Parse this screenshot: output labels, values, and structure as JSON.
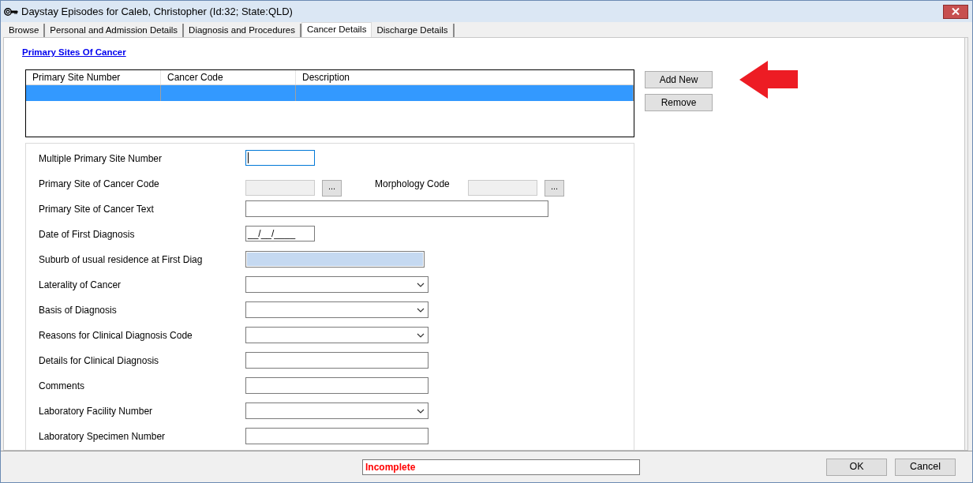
{
  "window": {
    "title": "Daystay Episodes for Caleb, Christopher (Id:32; State:QLD)"
  },
  "tabs": [
    {
      "label": "Browse",
      "selected": false
    },
    {
      "label": "Personal and Admission Details",
      "selected": false
    },
    {
      "label": "Diagnosis and Procedures",
      "selected": false
    },
    {
      "label": "Cancer Details",
      "selected": true
    },
    {
      "label": "Discharge Details",
      "selected": false
    }
  ],
  "section_link": "Primary Sites Of Cancer",
  "table": {
    "columns": [
      "Primary Site Number",
      "Cancer Code",
      "Description"
    ],
    "rows": [
      {
        "cells": [
          "",
          "",
          ""
        ],
        "selected": true
      }
    ]
  },
  "side_buttons": [
    "Add New",
    "Remove"
  ],
  "form": {
    "rows": [
      {
        "fields": [
          {
            "label": "Multiple Primary Site Number",
            "kind": "short-text",
            "focused": true
          }
        ]
      },
      {
        "fields": [
          {
            "label": "Primary Site of Cancer Code",
            "kind": "lookup",
            "button": "...",
            "focused": false
          },
          {
            "label": "Morphology Code",
            "kind": "lookup",
            "button": "...",
            "focused": false
          }
        ]
      },
      {
        "fields": [
          {
            "label": "Primary Site of Cancer Text",
            "kind": "long-text",
            "focused": false
          }
        ]
      },
      {
        "fields": [
          {
            "label": "Date of First Diagnosis",
            "kind": "date",
            "value": "__/__/____",
            "focused": false
          }
        ]
      },
      {
        "fields": [
          {
            "label": "Suburb of usual residence at First Diag",
            "kind": "readonly",
            "focused": false
          }
        ]
      },
      {
        "fields": [
          {
            "label": "Laterality of Cancer",
            "kind": "dropdown",
            "focused": false
          }
        ]
      },
      {
        "fields": [
          {
            "label": "Basis of Diagnosis",
            "kind": "dropdown",
            "focused": false
          }
        ]
      },
      {
        "fields": [
          {
            "label": "Reasons for Clinical Diagnosis Code",
            "kind": "dropdown",
            "focused": false
          }
        ]
      },
      {
        "fields": [
          {
            "label": "Details for Clinical Diagnosis",
            "kind": "text",
            "focused": false
          }
        ]
      },
      {
        "fields": [
          {
            "label": "Comments",
            "kind": "text",
            "focused": false
          }
        ]
      },
      {
        "fields": [
          {
            "label": "Laboratory Facility Number",
            "kind": "dropdown",
            "focused": false
          }
        ]
      },
      {
        "fields": [
          {
            "label": "Laboratory Specimen Number",
            "kind": "text",
            "focused": false
          }
        ]
      }
    ]
  },
  "status_field": {
    "value": "Incomplete"
  },
  "footer_buttons": [
    "OK",
    "Cancel"
  ]
}
